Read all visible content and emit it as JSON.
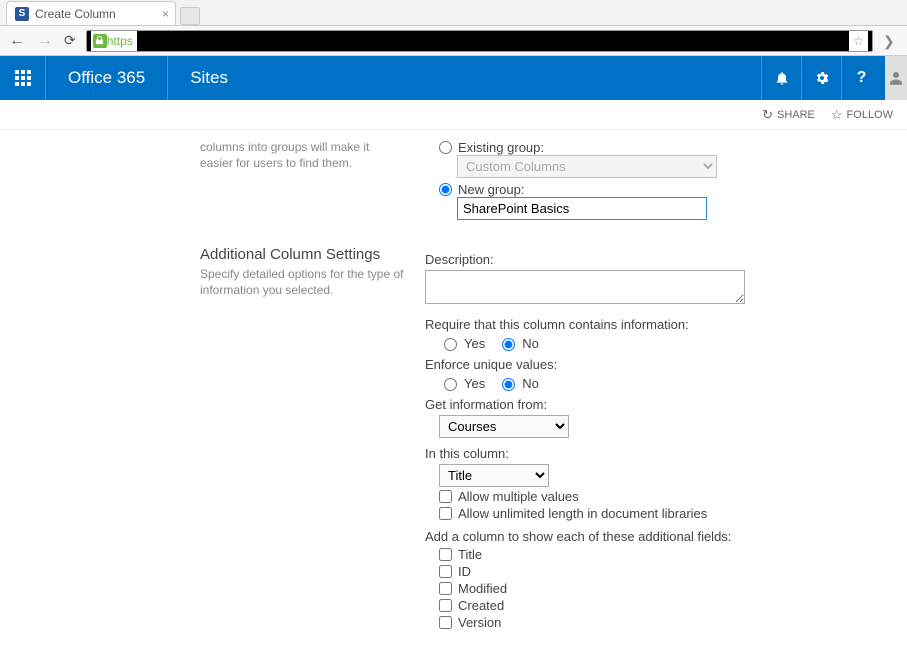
{
  "browser": {
    "tab_title": "Create Column",
    "url_prefix": "https"
  },
  "suite": {
    "brand": "Office 365",
    "site": "Sites"
  },
  "actions": {
    "share": "SHARE",
    "follow": "FOLLOW"
  },
  "group_section": {
    "truncated_desc": "columns into groups will make it easier for users to find them.",
    "existing_label": "Existing group:",
    "existing_value": "Custom Columns",
    "new_label": "New group:",
    "new_value": "SharePoint Basics"
  },
  "settings": {
    "title": "Additional Column Settings",
    "desc": "Specify detailed options for the type of information you selected.",
    "description_label": "Description:",
    "description_value": "",
    "require_label": "Require that this column contains information:",
    "enforce_label": "Enforce unique values:",
    "yes": "Yes",
    "no": "No",
    "get_info_label": "Get information from:",
    "get_info_value": "Courses",
    "in_col_label": "In this column:",
    "in_col_value": "Title",
    "allow_multi": "Allow multiple values",
    "allow_unlimited": "Allow unlimited length in document libraries",
    "add_fields_label": "Add a column to show each of these additional fields:",
    "fields": [
      "Title",
      "ID",
      "Modified",
      "Created",
      "Version"
    ]
  }
}
